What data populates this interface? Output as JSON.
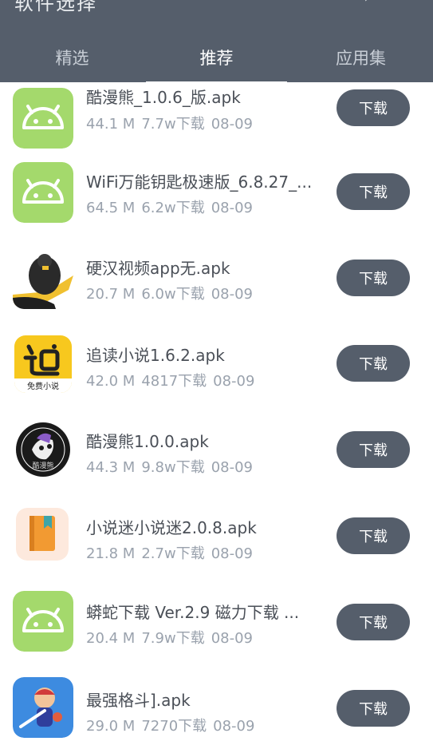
{
  "header": {
    "title": "软件选择",
    "tabs": [
      {
        "label": "精选",
        "active": false
      },
      {
        "label": "推荐",
        "active": true
      },
      {
        "label": "应用集",
        "active": false
      }
    ]
  },
  "colors": {
    "header_bg": "#555e6b",
    "button_bg": "#555e6b",
    "android_green": "#a4d96c",
    "meta_text": "#9aa2ad"
  },
  "apps": [
    {
      "name": "酷漫熊_1.0.6_版.apk",
      "size": "44.1 M",
      "downloads": "7.7w下载",
      "date": "08-09",
      "icon": "android-icon",
      "button": "下载"
    },
    {
      "name": "WiFi万能钥匙极速版_6.8.27_...",
      "size": "64.5 M",
      "downloads": "6.2w下载",
      "date": "08-09",
      "icon": "android-icon",
      "button": "下载"
    },
    {
      "name": "硬汉视频app无.apk",
      "size": "20.7 M",
      "downloads": "6.0w下载",
      "date": "08-09",
      "icon": "muscleman-icon",
      "button": "下载"
    },
    {
      "name": "追读小说1.6.2.apk",
      "size": "42.0 M",
      "downloads": "4817下载",
      "date": "08-09",
      "icon": "zhuidu-novel-icon",
      "button": "下载",
      "icon_caption": "免费小说"
    },
    {
      "name": "酷漫熊1.0.0.apk",
      "size": "44.3 M",
      "downloads": "9.8w下载",
      "date": "08-09",
      "icon": "kumanxiong-icon",
      "button": "下载",
      "icon_caption": "酷漫熊"
    },
    {
      "name": "小说迷小说迷2.0.8.apk",
      "size": "21.8 M",
      "downloads": "2.7w下载",
      "date": "08-09",
      "icon": "book-icon",
      "button": "下载"
    },
    {
      "name": "蟒蛇下载 Ver.2.9 磁力下载 ...",
      "size": "20.4 M",
      "downloads": "7.9w下载",
      "date": "08-09",
      "icon": "android-icon",
      "button": "下载"
    },
    {
      "name": "最强格斗].apk",
      "size": "29.0 M",
      "downloads": "7270下载",
      "date": "08-09",
      "icon": "fighter-game-icon",
      "button": "下载"
    }
  ]
}
